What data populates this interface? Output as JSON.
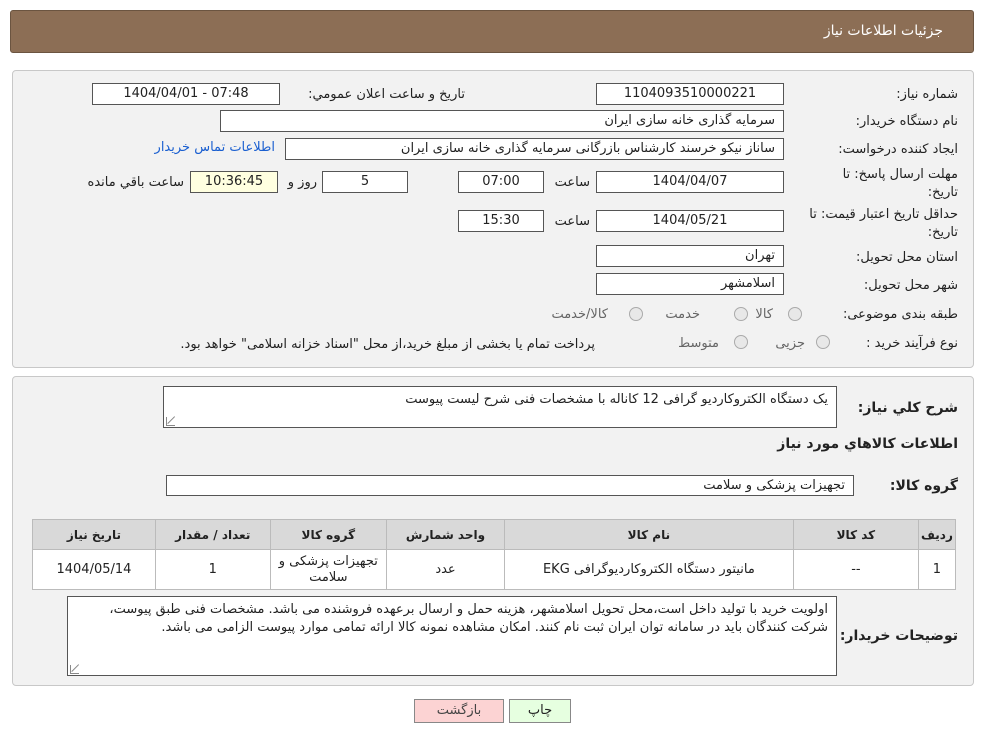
{
  "header": {
    "title": "جزئیات اطلاعات نیاز"
  },
  "form": {
    "need_number": {
      "label": "شماره نیاز:",
      "value": "1104093510000221"
    },
    "announce_datetime": {
      "label": "تاریخ و ساعت اعلان عمومي:",
      "value": "1404/04/01 - 07:48"
    },
    "buyer_org": {
      "label": "نام دستگاه خریدار:",
      "value": "سرمایه گذاری خانه سازی ایران"
    },
    "requester": {
      "label": "ایجاد کننده درخواست:",
      "value": "ساناز نیکو خرسند کارشناس بازرگانی سرمایه گذاری خانه سازی ایران",
      "contact_link": "اطلاعات تماس خریدار"
    },
    "reply_deadline": {
      "label": "مهلت ارسال پاسخ: تا تاریخ:",
      "date": "1404/04/07",
      "time_label": "ساعت",
      "time": "07:00",
      "days": "5",
      "days_label": "روز و",
      "remaining": "10:36:45",
      "remaining_label": "ساعت باقي مانده"
    },
    "price_validity": {
      "label": "حداقل تاریخ اعتبار قیمت: تا تاریخ:",
      "date": "1404/05/21",
      "time_label": "ساعت",
      "time": "15:30"
    },
    "delivery_province": {
      "label": "استان محل تحویل:",
      "value": "تهران"
    },
    "delivery_city": {
      "label": "شهر محل تحویل:",
      "value": "اسلامشهر"
    },
    "category": {
      "label": "طبقه بندی موضوعی:",
      "options": [
        "کالا",
        "خدمت",
        "کالا/خدمت"
      ]
    },
    "purchase_type": {
      "label": "نوع فرآیند خرید :",
      "options": [
        "جزیی",
        "متوسط"
      ],
      "note": "پرداخت تمام یا بخشی از مبلغ خرید،از محل \"اسناد خزانه اسلامی\" خواهد بود."
    }
  },
  "details": {
    "description_label": "شرح کلي نياز:",
    "description": "یک دستگاه الکتروکاردیو گرافی 12 کاناله با مشخصات فنی شرح لیست پیوست",
    "goods_info_title": "اطلاعات کالاهاي مورد نياز",
    "goods_group_label": "گروه کالا:",
    "goods_group": "تجهیزات پزشکی و سلامت",
    "table": {
      "headers": [
        "ردیف",
        "کد کالا",
        "نام کالا",
        "واحد شمارش",
        "گروه کالا",
        "تعداد / مقدار",
        "تاریخ نیاز"
      ],
      "rows": [
        [
          "1",
          "--",
          "مانیتور دستگاه الکتروکاردیوگرافی EKG",
          "عدد",
          "تجهیزات پزشکی و سلامت",
          "1",
          "1404/05/14"
        ]
      ]
    },
    "buyer_notes_label": "توضیحات خریدار:",
    "buyer_notes": "اولویت خرید با تولید داخل است،محل تحویل اسلامشهر، هزینه حمل و ارسال برعهده فروشنده می باشد. مشخصات فنی طبق پیوست، شرکت کنندگان باید در سامانه توان ایران ثبت نام کنند. امکان مشاهده نمونه کالا ارائه تمامی موارد پیوست الزامی می باشد."
  },
  "buttons": {
    "print": "چاپ",
    "back": "بازگشت"
  },
  "colors": {
    "header_bg": "#8c6e55",
    "link": "#1a5fd0",
    "back_btn": "#fcd3d3",
    "print_btn": "#e6ffe0"
  }
}
